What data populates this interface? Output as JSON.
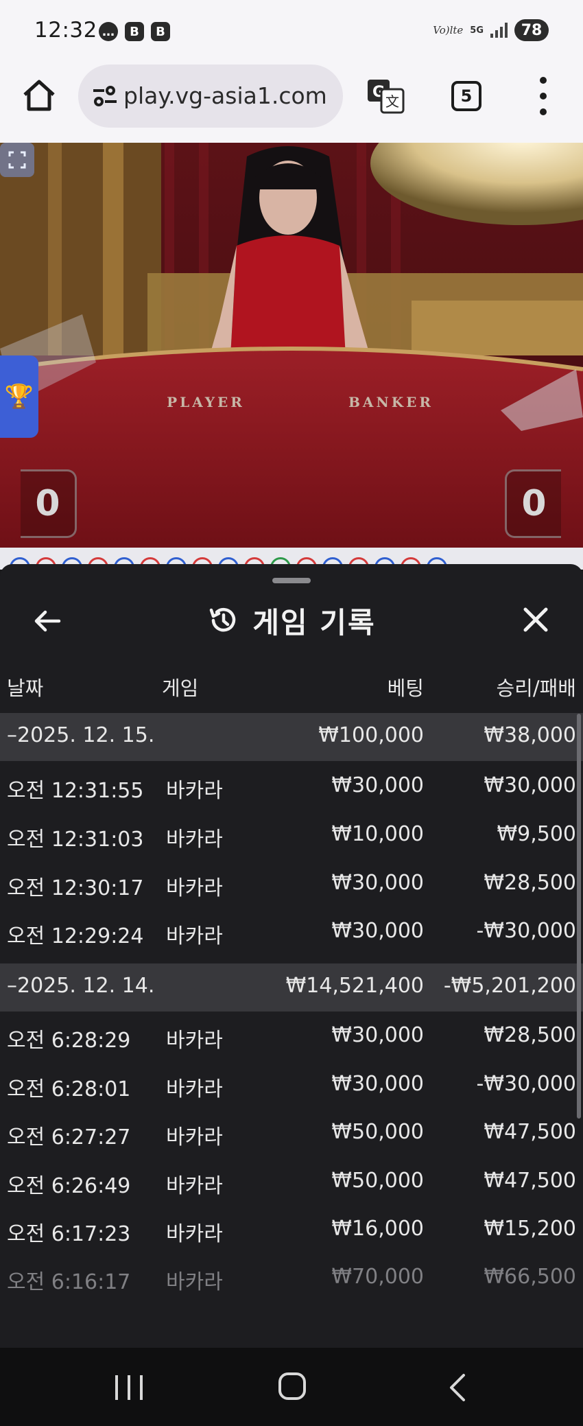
{
  "status_bar": {
    "time": "12:32",
    "notifications": [
      "chat",
      "B",
      "B"
    ],
    "volte": "Vo)lte",
    "network": "5G",
    "battery": "78"
  },
  "browser": {
    "url": "play.vg-asia1.com",
    "tab_count": "5",
    "icons": [
      "home-icon",
      "site-settings-icon",
      "translate-icon",
      "tabs-icon",
      "more-vert-icon"
    ]
  },
  "video": {
    "table_labels": {
      "player": "PLAYER",
      "banker": "BANKER"
    },
    "player_score": "0",
    "banker_score": "0",
    "icons": [
      "trophy-icon",
      "fullscreen-icon"
    ]
  },
  "history": {
    "title": "게임 기록",
    "columns": {
      "date": "날짜",
      "game": "게임",
      "bet": "베팅",
      "win_loss": "승리/패배"
    },
    "groups": [
      {
        "date": "–2025. 12. 15.",
        "total_bet": "₩100,000",
        "total_win": "₩38,000",
        "rows": [
          {
            "time": "오전 12:31:55",
            "game": "바카라",
            "bet": "₩30,000",
            "win": "₩30,000"
          },
          {
            "time": "오전 12:31:03",
            "game": "바카라",
            "bet": "₩10,000",
            "win": "₩9,500"
          },
          {
            "time": "오전 12:30:17",
            "game": "바카라",
            "bet": "₩30,000",
            "win": "₩28,500"
          },
          {
            "time": "오전 12:29:24",
            "game": "바카라",
            "bet": "₩30,000",
            "win": "-₩30,000"
          }
        ]
      },
      {
        "date": "–2025. 12. 14.",
        "total_bet": "₩14,521,400",
        "total_win": "-₩5,201,200",
        "rows": [
          {
            "time": "오전 6:28:29",
            "game": "바카라",
            "bet": "₩30,000",
            "win": "₩28,500"
          },
          {
            "time": "오전 6:28:01",
            "game": "바카라",
            "bet": "₩30,000",
            "win": "-₩30,000"
          },
          {
            "time": "오전 6:27:27",
            "game": "바카라",
            "bet": "₩50,000",
            "win": "₩47,500"
          },
          {
            "time": "오전 6:26:49",
            "game": "바카라",
            "bet": "₩50,000",
            "win": "₩47,500"
          },
          {
            "time": "오전 6:17:23",
            "game": "바카라",
            "bet": "₩16,000",
            "win": "₩15,200"
          },
          {
            "time": "오전 6:16:17",
            "game": "바카라",
            "bet": "₩70,000",
            "win": "₩66,500"
          }
        ]
      }
    ],
    "icons": [
      "back-arrow-icon",
      "history-icon",
      "close-icon"
    ]
  },
  "nav_bar": {
    "icons": [
      "recents-icon",
      "home-circle-icon",
      "back-chevron-icon"
    ]
  },
  "colors": {
    "panel_bg": "#1d1d20",
    "date_row_bg": "#38383c",
    "felt_red": "#8e1a22",
    "trophy_tab": "#3d5fd6"
  }
}
